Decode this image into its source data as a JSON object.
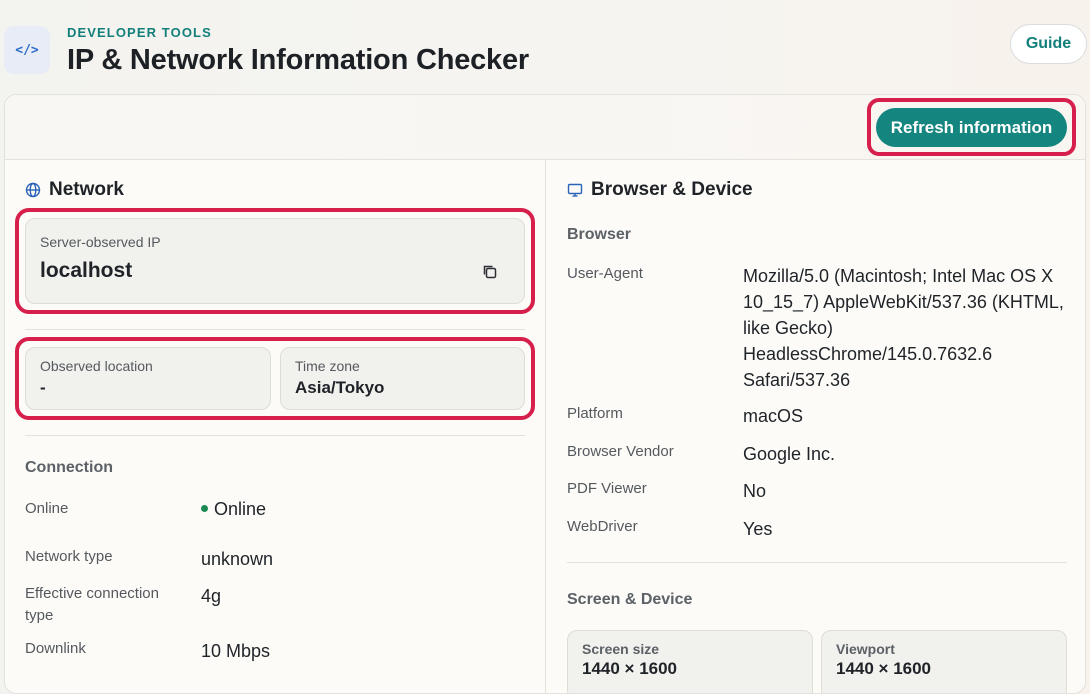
{
  "header": {
    "app_icon_label": "</>",
    "eyebrow": "DEVELOPER TOOLS",
    "title": "IP & Network Information Checker",
    "guide_label": "Guide"
  },
  "toolbar": {
    "refresh_label": "Refresh information"
  },
  "network": {
    "title": "Network",
    "ip_label": "Server-observed IP",
    "ip_value": "localhost",
    "location_label": "Observed location",
    "location_value": "-",
    "timezone_label": "Time zone",
    "timezone_value": "Asia/Tokyo",
    "connection": {
      "title": "Connection",
      "rows": [
        {
          "label": "Online",
          "value": "Online"
        },
        {
          "label": "Network type",
          "value": "unknown"
        },
        {
          "label": "Effective connection type",
          "value": "4g"
        },
        {
          "label": "Downlink",
          "value": "10 Mbps"
        }
      ]
    }
  },
  "browser_device": {
    "title": "Browser & Device",
    "browser": {
      "title": "Browser",
      "rows": [
        {
          "label": "User-Agent",
          "value": "Mozilla/5.0 (Macintosh; Intel Mac OS X 10_15_7) AppleWebKit/537.36 (KHTML, like Gecko) HeadlessChrome/145.0.7632.6 Safari/537.36"
        },
        {
          "label": "Platform",
          "value": "macOS"
        },
        {
          "label": "Browser Vendor",
          "value": "Google Inc."
        },
        {
          "label": "PDF Viewer",
          "value": "No"
        },
        {
          "label": "WebDriver",
          "value": "Yes"
        }
      ]
    },
    "screen": {
      "title": "Screen & Device",
      "screen_size_label": "Screen size",
      "screen_size_value": "1440 × 1600",
      "viewport_label": "Viewport",
      "viewport_value": "1440 × 1600"
    }
  },
  "colors": {
    "accent": "#15857f",
    "highlight": "#d61f4a",
    "online": "#1b8a52"
  }
}
